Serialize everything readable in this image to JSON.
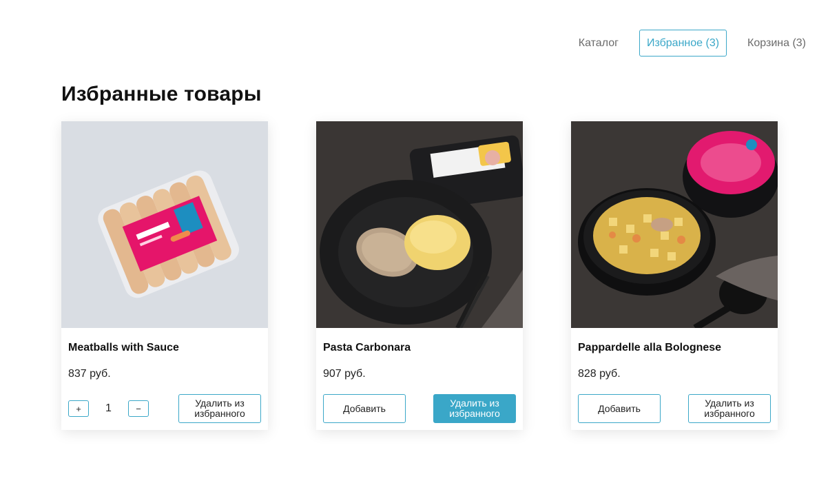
{
  "nav": {
    "catalog": "Каталог",
    "favorites": "Избранное (3)",
    "cart": "Корзина (3)"
  },
  "page": {
    "title": "Избранные товары"
  },
  "colors": {
    "accent": "#3aa7c8"
  },
  "products": [
    {
      "title": "Meatballs with Sauce",
      "price": "837 руб.",
      "quantity": "1",
      "plus_label": "+",
      "minus_label": "−",
      "remove_label": "Удалить из избранного",
      "image_icon": "sausages-package-image"
    },
    {
      "title": "Pasta Carbonara",
      "price": "907 руб.",
      "add_label": "Добавить",
      "remove_label": "Удалить из избранного",
      "image_icon": "cutlet-mashed-potato-image"
    },
    {
      "title": "Pappardelle alla Bolognese",
      "price": "828 руб.",
      "add_label": "Добавить",
      "remove_label": "Удалить из избранного",
      "image_icon": "chicken-soup-bowl-image"
    }
  ]
}
